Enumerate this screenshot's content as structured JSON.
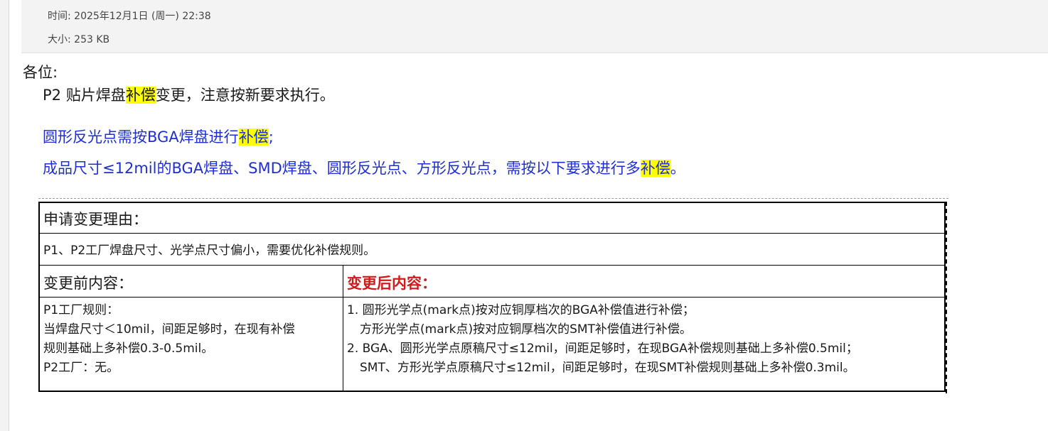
{
  "meta": {
    "time": "时间: 2025年12月1日 (周一) 22:38",
    "size": "大小: 253 KB"
  },
  "message": {
    "greeting": "各位:",
    "line1_prefix": "P2  贴片焊盘",
    "line1_highlight": "补偿",
    "line1_suffix": "变更，注意按新要求执行。",
    "line2_prefix": "圆形反光点需按BGA焊盘进行",
    "line2_highlight": "补偿",
    "line2_suffix": ";",
    "line3_prefix": "成品尺寸≤12mil的BGA焊盘、SMD焊盘、圆形反光点、方形反光点，需按以下要求进行多",
    "line3_highlight": "补偿",
    "line3_suffix": "。"
  },
  "table": {
    "reason_title": "申请变更理由：",
    "reason_text": "P1、P2工厂焊盘尺寸、光学点尺寸偏小，需要优化补偿规则。",
    "before_head": "变更前内容：",
    "after_head": "变更后内容：",
    "before_lines": [
      "P1工厂规则：",
      "当焊盘尺寸＜10mil，间距足够时，在现有补偿",
      "规则基础上多补偿0.3-0.5mil。",
      "P2工厂：无。"
    ],
    "after_lines": [
      "1. 圆形光学点(mark点)按对应铜厚档次的BGA补偿值进行补偿；",
      "方形光学点(mark点)按对应铜厚档次的SMT补偿值进行补偿。",
      "2. BGA、圆形光学点原稿尺寸≤12mil，间距足够时，在现BGA补偿规则基础上多补偿0.5mil；",
      "SMT、方形光学点原稿尺寸≤12mil，间距足够时，在现SMT补偿规则基础上多补偿0.3mil。"
    ]
  },
  "colors": {
    "blue_text": "#1f2fd6",
    "highlight": "#ffff00",
    "red_head": "#d11b1b"
  }
}
